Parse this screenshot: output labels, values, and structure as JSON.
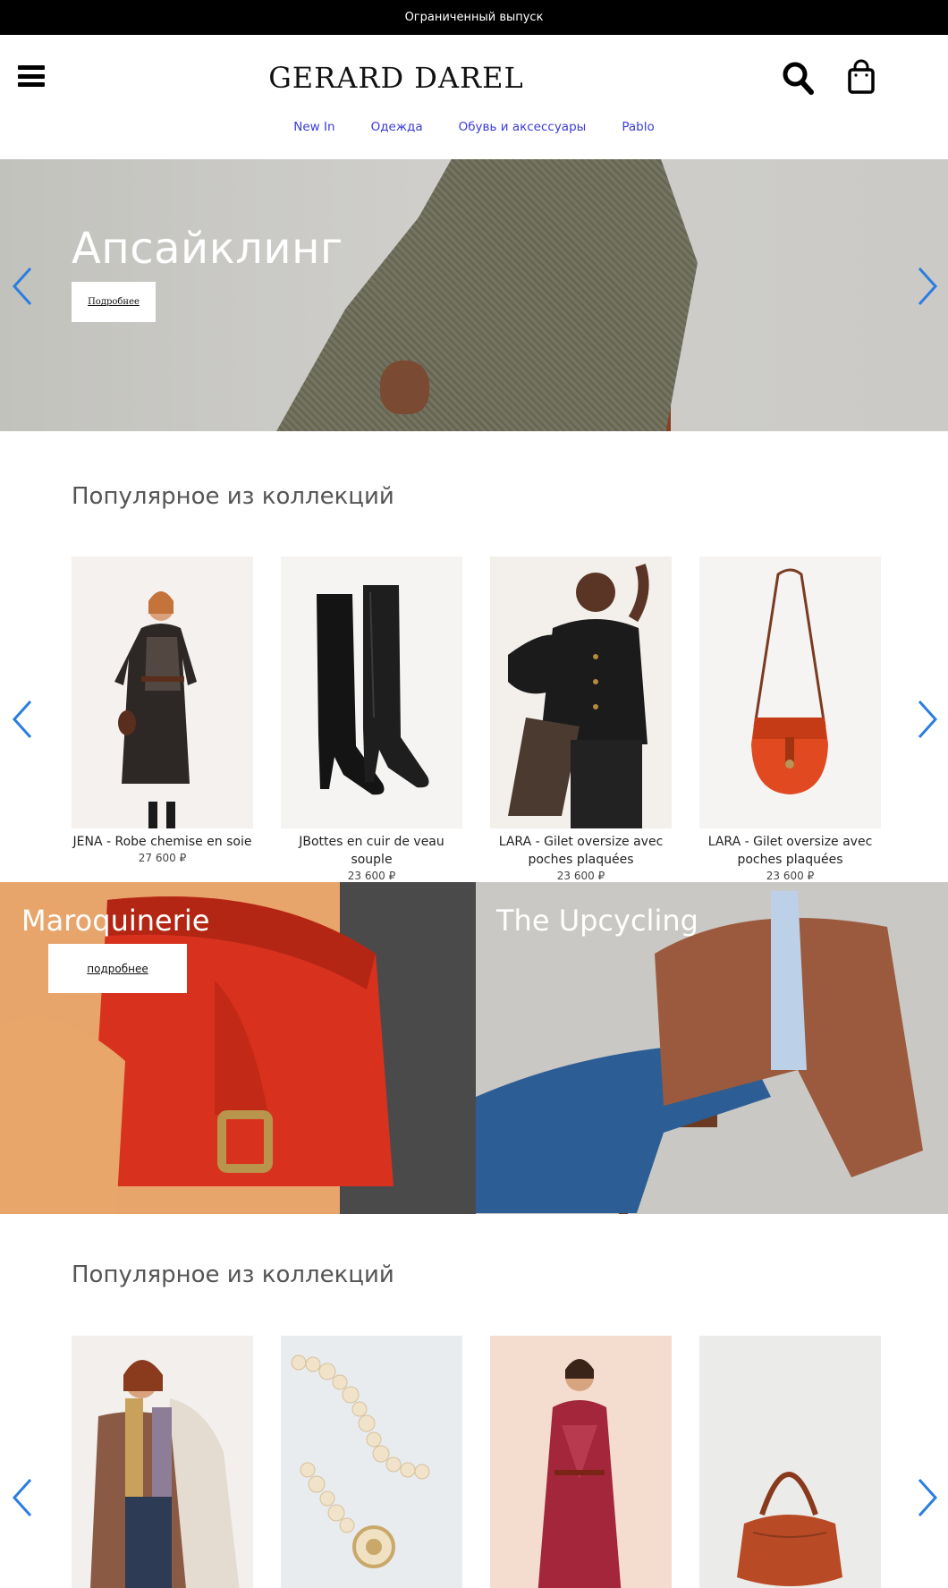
{
  "promo": {
    "text": "Ограниченный выпуск"
  },
  "header": {
    "logo": "GERARD DAREL",
    "menu_icon": "hamburger-menu-icon",
    "search_icon": "search-icon",
    "cart_icon": "shopping-bag-icon",
    "nav": [
      "New In",
      "Одежда",
      "Обувь и аксессуары",
      "Pablo"
    ]
  },
  "hero": {
    "title": "Апсайклинг",
    "button": "Подробнее"
  },
  "section1": {
    "title": "Популярное из коллекций",
    "products": [
      {
        "name": "JENA - Robe chemise en soie",
        "price": "27 600 ₽"
      },
      {
        "name": "JBottes en cuir de veau souple",
        "price": "23 600 ₽"
      },
      {
        "name": "LARA - Gilet oversize avec poches plaquées",
        "price": "23 600 ₽"
      },
      {
        "name": "LARA - Gilet oversize avec poches plaquées",
        "price": "23 600 ₽"
      }
    ]
  },
  "banners": {
    "left": {
      "title": "Maroquinerie",
      "button": "подробнее"
    },
    "right": {
      "title": "The Upcycling"
    }
  },
  "section2": {
    "title": "Популярное из коллекций"
  },
  "colors": {
    "promo_bg": "#000000",
    "nav_link": "#3b3bd6",
    "arrow": "#2a7de1"
  }
}
